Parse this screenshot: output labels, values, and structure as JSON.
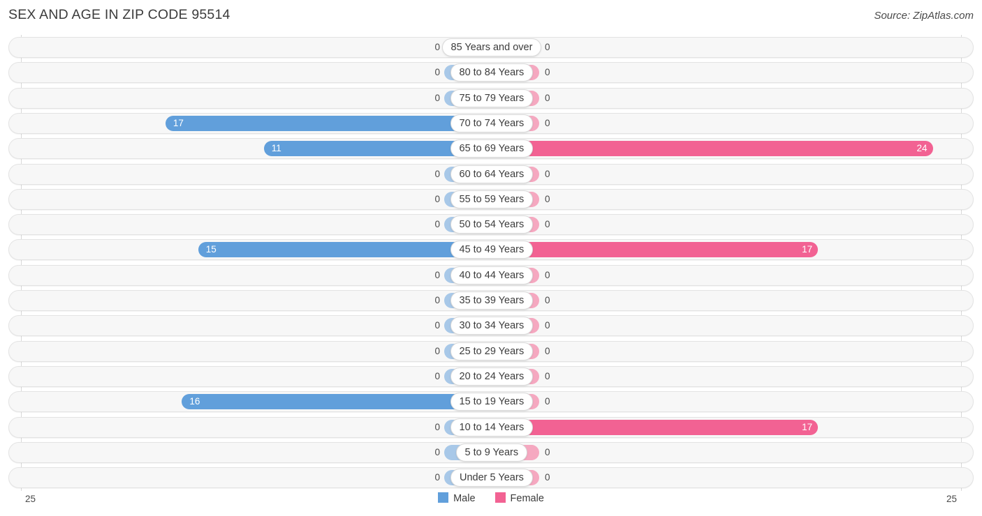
{
  "header": {
    "title": "SEX AND AGE IN ZIP CODE 95514",
    "source": "Source: ZipAtlas.com"
  },
  "legend": {
    "male_label": "Male",
    "female_label": "Female",
    "male_color": "#619fdb",
    "female_color": "#f26293"
  },
  "axis": {
    "left_label": "25",
    "right_label": "25",
    "max": 25
  },
  "chart_data": {
    "type": "bar",
    "title": "SEX AND AGE IN ZIP CODE 95514",
    "subtitle": "Source: ZipAtlas.com",
    "orientation": "horizontal",
    "style": "population-pyramid",
    "xlabel": "",
    "ylabel": "",
    "xlim": [
      -25,
      25
    ],
    "grid": false,
    "legend_position": "bottom-center",
    "categories": [
      "85 Years and over",
      "80 to 84 Years",
      "75 to 79 Years",
      "70 to 74 Years",
      "65 to 69 Years",
      "60 to 64 Years",
      "55 to 59 Years",
      "50 to 54 Years",
      "45 to 49 Years",
      "40 to 44 Years",
      "35 to 39 Years",
      "30 to 34 Years",
      "25 to 29 Years",
      "20 to 24 Years",
      "15 to 19 Years",
      "10 to 14 Years",
      "5 to 9 Years",
      "Under 5 Years"
    ],
    "series": [
      {
        "name": "Male",
        "color": "#619fdb",
        "values": [
          0,
          0,
          0,
          17,
          11,
          0,
          0,
          0,
          15,
          0,
          0,
          0,
          0,
          0,
          16,
          0,
          0,
          0
        ]
      },
      {
        "name": "Female",
        "color": "#f26293",
        "values": [
          0,
          0,
          0,
          0,
          24,
          0,
          0,
          0,
          17,
          0,
          0,
          0,
          0,
          0,
          0,
          17,
          0,
          0
        ]
      }
    ]
  },
  "rows": [
    {
      "age": "85 Years and over",
      "male": "0",
      "female": "0"
    },
    {
      "age": "80 to 84 Years",
      "male": "0",
      "female": "0"
    },
    {
      "age": "75 to 79 Years",
      "male": "0",
      "female": "0"
    },
    {
      "age": "70 to 74 Years",
      "male": "17",
      "female": "0"
    },
    {
      "age": "65 to 69 Years",
      "male": "11",
      "female": "24"
    },
    {
      "age": "60 to 64 Years",
      "male": "0",
      "female": "0"
    },
    {
      "age": "55 to 59 Years",
      "male": "0",
      "female": "0"
    },
    {
      "age": "50 to 54 Years",
      "male": "0",
      "female": "0"
    },
    {
      "age": "45 to 49 Years",
      "male": "15",
      "female": "17"
    },
    {
      "age": "40 to 44 Years",
      "male": "0",
      "female": "0"
    },
    {
      "age": "35 to 39 Years",
      "male": "0",
      "female": "0"
    },
    {
      "age": "30 to 34 Years",
      "male": "0",
      "female": "0"
    },
    {
      "age": "25 to 29 Years",
      "male": "0",
      "female": "0"
    },
    {
      "age": "20 to 24 Years",
      "male": "0",
      "female": "0"
    },
    {
      "age": "15 to 19 Years",
      "male": "16",
      "female": "0"
    },
    {
      "age": "10 to 14 Years",
      "male": "0",
      "female": "17"
    },
    {
      "age": "5 to 9 Years",
      "male": "0",
      "female": "0"
    },
    {
      "age": "Under 5 Years",
      "male": "0",
      "female": "0"
    }
  ]
}
